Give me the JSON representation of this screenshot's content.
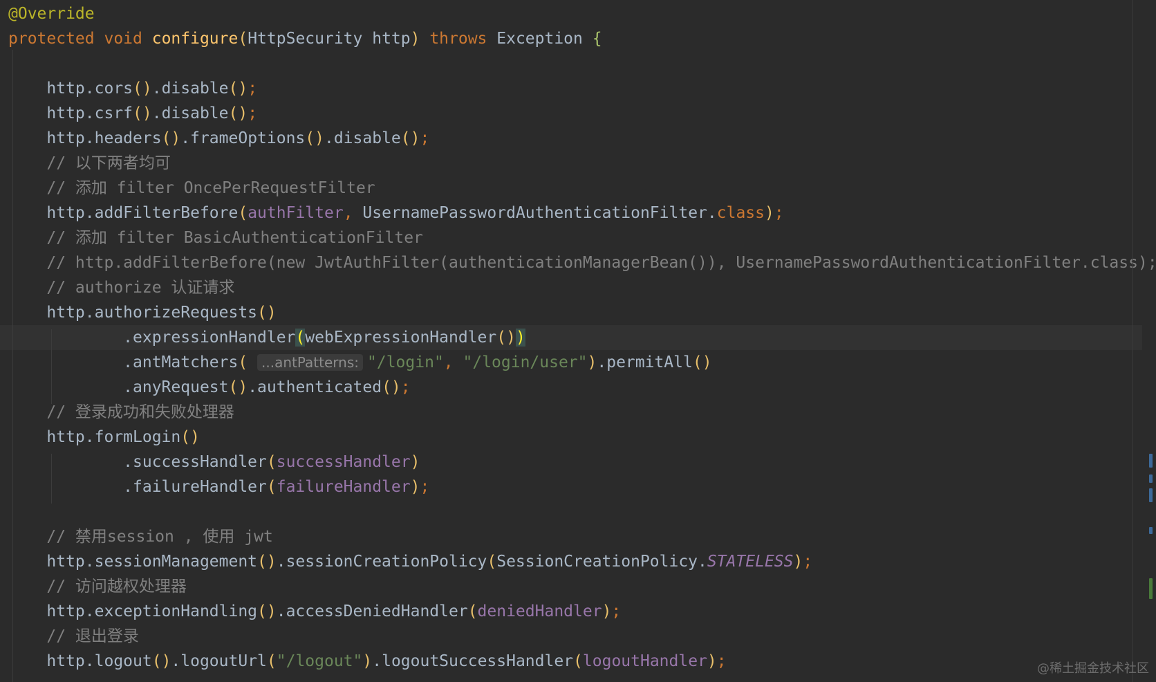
{
  "editor": {
    "current_line_index": 13,
    "lines": [
      {
        "tokens": [
          {
            "t": "@Override",
            "c": "annotation"
          }
        ]
      },
      {
        "tokens": [
          {
            "t": "protected void ",
            "c": "keyword"
          },
          {
            "t": "configure",
            "c": "method"
          },
          {
            "t": "(",
            "c": "paren"
          },
          {
            "t": "HttpSecurity http",
            "c": "plain"
          },
          {
            "t": ")",
            "c": "paren"
          },
          {
            "t": " throws ",
            "c": "keyword"
          },
          {
            "t": "Exception ",
            "c": "plain"
          },
          {
            "t": "{",
            "c": "brace"
          }
        ]
      },
      {
        "tokens": []
      },
      {
        "tokens": [
          {
            "t": "    http.cors",
            "c": "plain"
          },
          {
            "t": "()",
            "c": "paren"
          },
          {
            "t": ".disable",
            "c": "plain"
          },
          {
            "t": "()",
            "c": "paren"
          },
          {
            "t": ";",
            "c": "punct"
          }
        ]
      },
      {
        "tokens": [
          {
            "t": "    http.csrf",
            "c": "plain"
          },
          {
            "t": "()",
            "c": "paren"
          },
          {
            "t": ".disable",
            "c": "plain"
          },
          {
            "t": "()",
            "c": "paren"
          },
          {
            "t": ";",
            "c": "punct"
          }
        ]
      },
      {
        "tokens": [
          {
            "t": "    http.headers",
            "c": "plain"
          },
          {
            "t": "()",
            "c": "paren"
          },
          {
            "t": ".frameOptions",
            "c": "plain"
          },
          {
            "t": "()",
            "c": "paren"
          },
          {
            "t": ".disable",
            "c": "plain"
          },
          {
            "t": "()",
            "c": "paren"
          },
          {
            "t": ";",
            "c": "punct"
          }
        ]
      },
      {
        "tokens": [
          {
            "t": "    // 以下两者均可",
            "c": "comment"
          }
        ]
      },
      {
        "tokens": [
          {
            "t": "    // 添加 filter OncePerRequestFilter",
            "c": "comment"
          }
        ]
      },
      {
        "tokens": [
          {
            "t": "    http.addFilterBefore",
            "c": "plain"
          },
          {
            "t": "(",
            "c": "paren"
          },
          {
            "t": "authFilter",
            "c": "field"
          },
          {
            "t": ", ",
            "c": "punct"
          },
          {
            "t": "UsernamePasswordAuthenticationFilter.",
            "c": "plain"
          },
          {
            "t": "class",
            "c": "keyword"
          },
          {
            "t": ")",
            "c": "paren"
          },
          {
            "t": ";",
            "c": "punct"
          }
        ]
      },
      {
        "tokens": [
          {
            "t": "    // 添加 filter BasicAuthenticationFilter",
            "c": "comment"
          }
        ]
      },
      {
        "tokens": [
          {
            "t": "    // http.addFilterBefore(new JwtAuthFilter(authenticationManagerBean()), UsernamePasswordAuthenticationFilter.class);",
            "c": "comment"
          }
        ]
      },
      {
        "tokens": [
          {
            "t": "    // authorize 认证请求",
            "c": "comment"
          }
        ]
      },
      {
        "tokens": [
          {
            "t": "    http.authorizeRequests",
            "c": "plain"
          },
          {
            "t": "()",
            "c": "paren"
          }
        ]
      },
      {
        "tokens": [
          {
            "t": "            .expressionHandler",
            "c": "plain"
          },
          {
            "t": "(",
            "c": "bracket-match"
          },
          {
            "t": "webExpressionHandler",
            "c": "plain"
          },
          {
            "t": "()",
            "c": "paren"
          },
          {
            "t": ")",
            "c": "bracket-match"
          }
        ]
      },
      {
        "tokens": [
          {
            "t": "            .antMatchers",
            "c": "plain"
          },
          {
            "t": "( ",
            "c": "paren"
          },
          {
            "t": "...antPatterns:",
            "c": "hint"
          },
          {
            "t": "\"/login\"",
            "c": "string"
          },
          {
            "t": ", ",
            "c": "punct"
          },
          {
            "t": "\"/login/user\"",
            "c": "string"
          },
          {
            "t": ")",
            "c": "paren"
          },
          {
            "t": ".permitAll",
            "c": "plain"
          },
          {
            "t": "()",
            "c": "paren"
          }
        ]
      },
      {
        "tokens": [
          {
            "t": "            .anyRequest",
            "c": "plain"
          },
          {
            "t": "()",
            "c": "paren"
          },
          {
            "t": ".authenticated",
            "c": "plain"
          },
          {
            "t": "()",
            "c": "paren"
          },
          {
            "t": ";",
            "c": "punct"
          }
        ]
      },
      {
        "tokens": [
          {
            "t": "    // 登录成功和失败处理器",
            "c": "comment"
          }
        ]
      },
      {
        "tokens": [
          {
            "t": "    http.formLogin",
            "c": "plain"
          },
          {
            "t": "()",
            "c": "paren"
          }
        ]
      },
      {
        "tokens": [
          {
            "t": "            .successHandler",
            "c": "plain"
          },
          {
            "t": "(",
            "c": "paren"
          },
          {
            "t": "successHandler",
            "c": "field"
          },
          {
            "t": ")",
            "c": "paren"
          }
        ]
      },
      {
        "tokens": [
          {
            "t": "            .failureHandler",
            "c": "plain"
          },
          {
            "t": "(",
            "c": "paren"
          },
          {
            "t": "failureHandler",
            "c": "field"
          },
          {
            "t": ")",
            "c": "paren"
          },
          {
            "t": ";",
            "c": "punct"
          }
        ]
      },
      {
        "tokens": []
      },
      {
        "tokens": [
          {
            "t": "    // 禁用session , 使用 jwt",
            "c": "comment"
          }
        ]
      },
      {
        "tokens": [
          {
            "t": "    http.sessionManagement",
            "c": "plain"
          },
          {
            "t": "()",
            "c": "paren"
          },
          {
            "t": ".sessionCreationPolicy",
            "c": "plain"
          },
          {
            "t": "(",
            "c": "paren"
          },
          {
            "t": "SessionCreationPolicy.",
            "c": "plain"
          },
          {
            "t": "STATELESS",
            "c": "static"
          },
          {
            "t": ")",
            "c": "paren"
          },
          {
            "t": ";",
            "c": "punct"
          }
        ]
      },
      {
        "tokens": [
          {
            "t": "    // 访问越权处理器",
            "c": "comment"
          }
        ]
      },
      {
        "tokens": [
          {
            "t": "    http.exceptionHandling",
            "c": "plain"
          },
          {
            "t": "()",
            "c": "paren"
          },
          {
            "t": ".accessDeniedHandler",
            "c": "plain"
          },
          {
            "t": "(",
            "c": "paren"
          },
          {
            "t": "deniedHandler",
            "c": "field"
          },
          {
            "t": ")",
            "c": "paren"
          },
          {
            "t": ";",
            "c": "punct"
          }
        ]
      },
      {
        "tokens": [
          {
            "t": "    // 退出登录",
            "c": "comment"
          }
        ]
      },
      {
        "tokens": [
          {
            "t": "    http.logout",
            "c": "plain"
          },
          {
            "t": "()",
            "c": "paren"
          },
          {
            "t": ".logoutUrl",
            "c": "plain"
          },
          {
            "t": "(",
            "c": "paren"
          },
          {
            "t": "\"/logout\"",
            "c": "string"
          },
          {
            "t": ")",
            "c": "paren"
          },
          {
            "t": ".logoutSuccessHandler",
            "c": "plain"
          },
          {
            "t": "(",
            "c": "paren"
          },
          {
            "t": "logoutHandler",
            "c": "field"
          },
          {
            "t": ")",
            "c": "paren"
          },
          {
            "t": ";",
            "c": "punct"
          }
        ]
      }
    ]
  },
  "watermark": "@稀土掘金技术社区",
  "colors": {
    "background": "#2b2b2b",
    "annotation": "#bbb529",
    "keyword": "#cc7832",
    "method": "#ffc66d",
    "plain": "#a9b7c6",
    "comment": "#808080",
    "field": "#9876aa",
    "string": "#6a8759",
    "paren": "#e8bf6a"
  }
}
